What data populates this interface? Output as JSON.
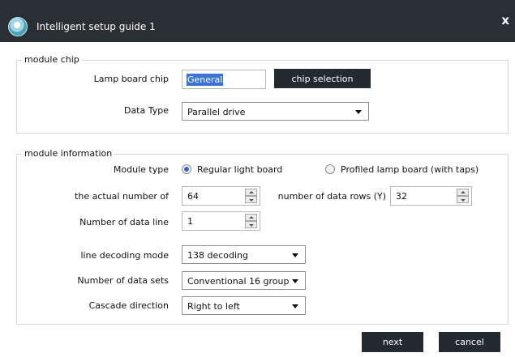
{
  "window": {
    "title": "Intelligent setup guide 1",
    "close_symbol": "x",
    "app_icon": "app-logo-icon"
  },
  "module_chip": {
    "legend": "module chip",
    "lamp_board_chip_label": "Lamp board chip",
    "lamp_board_chip_value": "General",
    "chip_selection_button": "chip selection",
    "data_type_label": "Data Type",
    "data_type_value": "Parallel drive"
  },
  "module_information": {
    "legend": "module information",
    "module_type_label": "Module type",
    "module_type_options": [
      {
        "label": "Regular light board",
        "selected": true
      },
      {
        "label": "Profiled lamp board (with taps)",
        "selected": false
      }
    ],
    "actual_number_label": "the actual number of",
    "actual_number_value": "64",
    "data_rows_label": "number of data rows (Y)",
    "data_rows_value": "32",
    "data_line_label": "Number of data line",
    "data_line_value": "1",
    "line_decoding_label": "line decoding mode",
    "line_decoding_value": "138 decoding",
    "data_sets_label": "Number of data sets",
    "data_sets_value": "Conventional 16 group",
    "cascade_label": "Cascade direction",
    "cascade_value": "Right to left"
  },
  "footer": {
    "next_label": "next",
    "cancel_label": "cancel"
  },
  "colors": {
    "titlebar": "#2a2f34",
    "dark_button": "#242a31",
    "selection": "#3a73d8"
  }
}
